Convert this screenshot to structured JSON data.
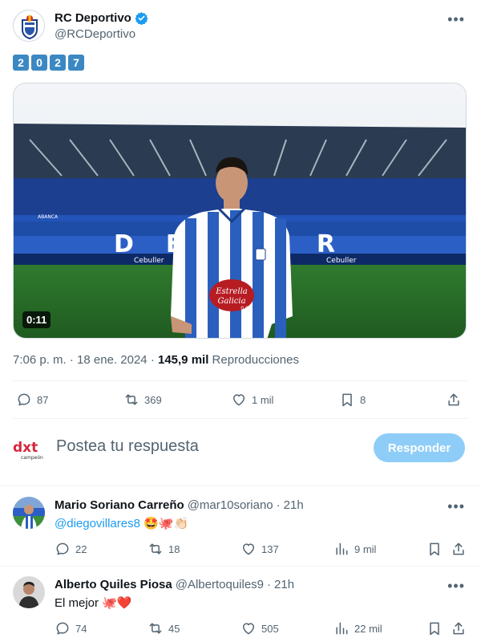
{
  "tweet": {
    "author_name": "RC Deportivo",
    "author_handle": "@RCDeportivo",
    "text_digits": [
      "2",
      "0",
      "2",
      "7"
    ],
    "video_duration": "0:11",
    "time": "7:06 p. m.",
    "date": "18 ene. 2024",
    "views_count": "145,9 mil",
    "views_label": "Reproducciones",
    "stats": {
      "replies": "87",
      "retweets": "369",
      "likes": "1 mil",
      "bookmarks": "8"
    },
    "video_scene": {
      "stadium_letters": "DEPOR",
      "sponsor_top": "Estrella",
      "sponsor_bottom": "Galicia",
      "sponsor_sub": "0,0",
      "board_text": "ABANCA",
      "ad_text": "Cebuller"
    }
  },
  "compose": {
    "logo_text": "dxt",
    "logo_sub": "campeón",
    "placeholder": "Postea tu respuesta",
    "button_label": "Responder"
  },
  "replies": [
    {
      "name": "Mario Soriano Carreño",
      "handle": "@mar10soriano",
      "time": "21h",
      "mention": "@diegovillares8",
      "text": "",
      "emoji": "🤩🐙👏🏻",
      "stats": {
        "replies": "22",
        "retweets": "18",
        "likes": "137",
        "views": "9 mil"
      }
    },
    {
      "name": "Alberto Quiles Piosa",
      "handle": "@Albertoquiles9",
      "time": "21h",
      "mention": "",
      "text": "El mejor",
      "emoji": "🐙❤️",
      "stats": {
        "replies": "74",
        "retweets": "45",
        "likes": "505",
        "views": "22 mil"
      }
    }
  ],
  "colors": {
    "accent": "#1d9bf0",
    "muted": "#536471",
    "button_disabled": "#8ecdf8",
    "digit_bg": "#3b88c3"
  }
}
